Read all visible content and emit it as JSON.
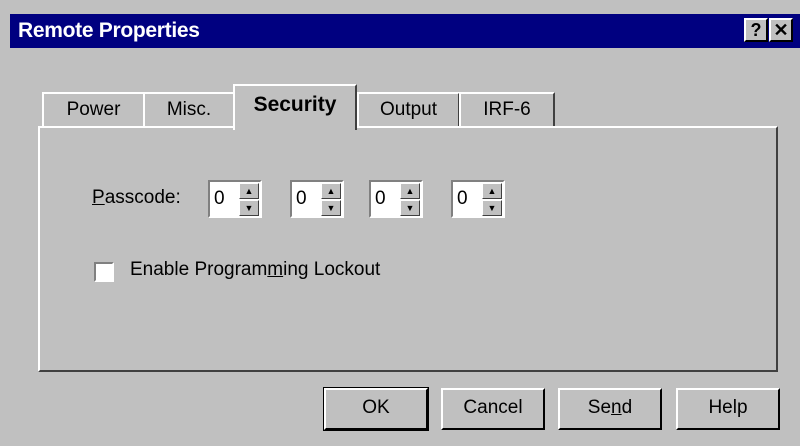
{
  "window": {
    "title": "Remote Properties",
    "help_glyph": "?",
    "close_glyph": "✕"
  },
  "tabs": [
    {
      "label": "Power"
    },
    {
      "label": "Misc."
    },
    {
      "label": "Security"
    },
    {
      "label": "Output"
    },
    {
      "label": "IRF-6"
    }
  ],
  "active_tab": "Security",
  "security": {
    "passcode_label_accel": "P",
    "passcode_label_rest": "asscode:",
    "passcode_digits": [
      "0",
      "0",
      "0",
      "0"
    ],
    "lockout_label_pre": "Enable Program",
    "lockout_label_accel": "m",
    "lockout_label_post": "ing Lockout",
    "lockout_checked": false
  },
  "buttons": {
    "ok": "OK",
    "cancel": "Cancel",
    "send_pre": "Se",
    "send_accel": "n",
    "send_post": "d",
    "help": "Help"
  },
  "icons": {
    "spin_up": "up-arrow-icon",
    "spin_down": "down-arrow-icon"
  }
}
